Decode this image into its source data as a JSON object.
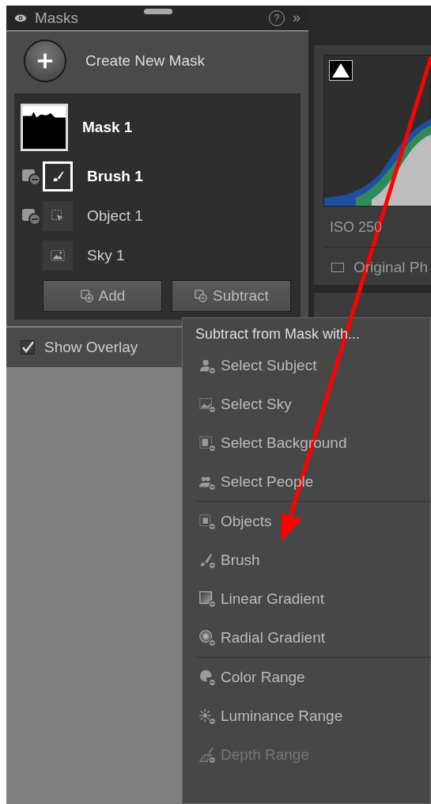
{
  "panel": {
    "title": "Masks",
    "help": "?",
    "collapse": "»"
  },
  "create_button": {
    "label": "Create New Mask"
  },
  "masks": [
    {
      "name": "Mask 1",
      "selected": true,
      "components": [
        {
          "name": "Brush 1",
          "kind": "brush",
          "subtract": true,
          "selected": true
        },
        {
          "name": "Object 1",
          "kind": "object",
          "subtract": true,
          "selected": false
        },
        {
          "name": "Sky 1",
          "kind": "sky",
          "subtract": false,
          "selected": false
        }
      ]
    }
  ],
  "mask_buttons": [
    "Add",
    "Subtract"
  ],
  "show_overlay": {
    "label": "Show Overlay",
    "checked": true
  },
  "histogram": {
    "iso": "ISO 250",
    "original_photo": {
      "label": "Original Ph",
      "checked": false
    }
  },
  "menu": {
    "title": "Subtract from Mask with...",
    "groups": [
      [
        {
          "label": "Select Subject",
          "kind": "subject",
          "disabled": false
        },
        {
          "label": "Select Sky",
          "kind": "sky",
          "disabled": false
        },
        {
          "label": "Select Background",
          "kind": "background",
          "disabled": false
        },
        {
          "label": "Select People",
          "kind": "people",
          "disabled": false
        }
      ],
      [
        {
          "label": "Objects",
          "kind": "objects",
          "disabled": false
        },
        {
          "label": "Brush",
          "kind": "brush",
          "disabled": false
        },
        {
          "label": "Linear Gradient",
          "kind": "linear",
          "disabled": false
        },
        {
          "label": "Radial Gradient",
          "kind": "radial",
          "disabled": false
        }
      ],
      [
        {
          "label": "Color Range",
          "kind": "color",
          "disabled": false
        },
        {
          "label": "Luminance Range",
          "kind": "luminance",
          "disabled": false
        },
        {
          "label": "Depth Range",
          "kind": "depth",
          "disabled": true
        }
      ]
    ]
  }
}
